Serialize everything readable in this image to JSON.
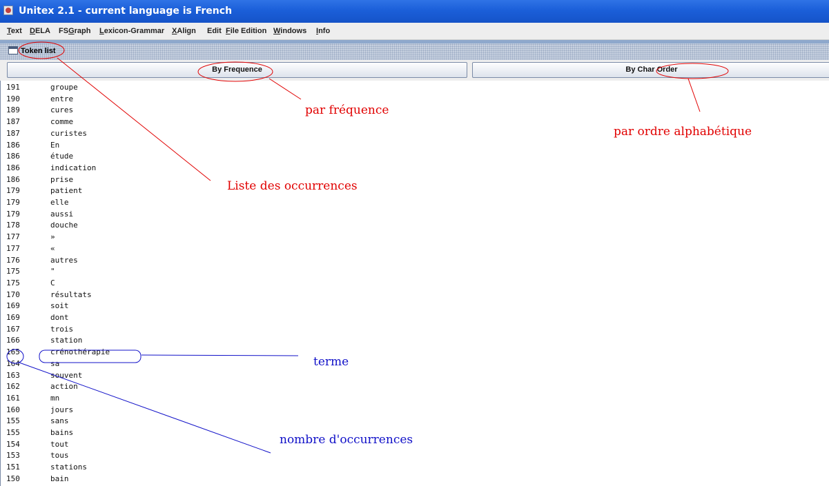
{
  "window": {
    "title": "Unitex 2.1 - current language is French",
    "icon": "unitex-app-icon"
  },
  "menu": {
    "items": [
      {
        "mnemonic": "T",
        "rest": "ext"
      },
      {
        "mnemonic": "D",
        "rest": "ELA"
      },
      {
        "mnemonic": "",
        "rest": "FS"
      },
      {
        "mnemonic": "G",
        "rest": "raph"
      },
      {
        "mnemonic": "L",
        "rest": "exicon-Grammar"
      },
      {
        "mnemonic": "X",
        "rest": "Align"
      },
      {
        "mnemonic": "",
        "rest": "Edit"
      },
      {
        "mnemonic": "F",
        "rest": "ile Edition"
      },
      {
        "mnemonic": "W",
        "rest": "indows"
      },
      {
        "mnemonic": "I",
        "rest": "nfo"
      }
    ]
  },
  "frame": {
    "title": "Token list",
    "icon": "frame-icon"
  },
  "buttons": {
    "by_frequence": "By Frequence",
    "by_char_order": "By Char Order"
  },
  "tokens": [
    {
      "count": "191",
      "term": "groupe"
    },
    {
      "count": "190",
      "term": "entre"
    },
    {
      "count": "189",
      "term": "cures"
    },
    {
      "count": "187",
      "term": "comme"
    },
    {
      "count": "187",
      "term": "curistes"
    },
    {
      "count": "186",
      "term": "En"
    },
    {
      "count": "186",
      "term": "étude"
    },
    {
      "count": "186",
      "term": "indication"
    },
    {
      "count": "186",
      "term": "prise"
    },
    {
      "count": "179",
      "term": "patient"
    },
    {
      "count": "179",
      "term": "elle"
    },
    {
      "count": "179",
      "term": "aussi"
    },
    {
      "count": "178",
      "term": "douche"
    },
    {
      "count": "177",
      "term": "»"
    },
    {
      "count": "177",
      "term": "«"
    },
    {
      "count": "176",
      "term": "autres"
    },
    {
      "count": "175",
      "term": "\""
    },
    {
      "count": "175",
      "term": "C"
    },
    {
      "count": "170",
      "term": "résultats"
    },
    {
      "count": "169",
      "term": "soit"
    },
    {
      "count": "169",
      "term": "dont"
    },
    {
      "count": "167",
      "term": "trois"
    },
    {
      "count": "166",
      "term": "station"
    },
    {
      "count": "165",
      "term": "crénothérapie"
    },
    {
      "count": "164",
      "term": "sa"
    },
    {
      "count": "163",
      "term": "souvent"
    },
    {
      "count": "162",
      "term": "action"
    },
    {
      "count": "161",
      "term": "mn"
    },
    {
      "count": "160",
      "term": "jours"
    },
    {
      "count": "155",
      "term": "sans"
    },
    {
      "count": "155",
      "term": "bains"
    },
    {
      "count": "154",
      "term": "tout"
    },
    {
      "count": "153",
      "term": "tous"
    },
    {
      "count": "151",
      "term": "stations"
    },
    {
      "count": "150",
      "term": "bain"
    }
  ],
  "annotations": {
    "par_frequence": "par fréquence",
    "par_ordre": "par ordre alphabétique",
    "liste": "Liste des occurrences",
    "terme": "terme",
    "nombre": "nombre d'occurrences",
    "red_color": "#e10000",
    "blue_color": "#1010c8"
  }
}
